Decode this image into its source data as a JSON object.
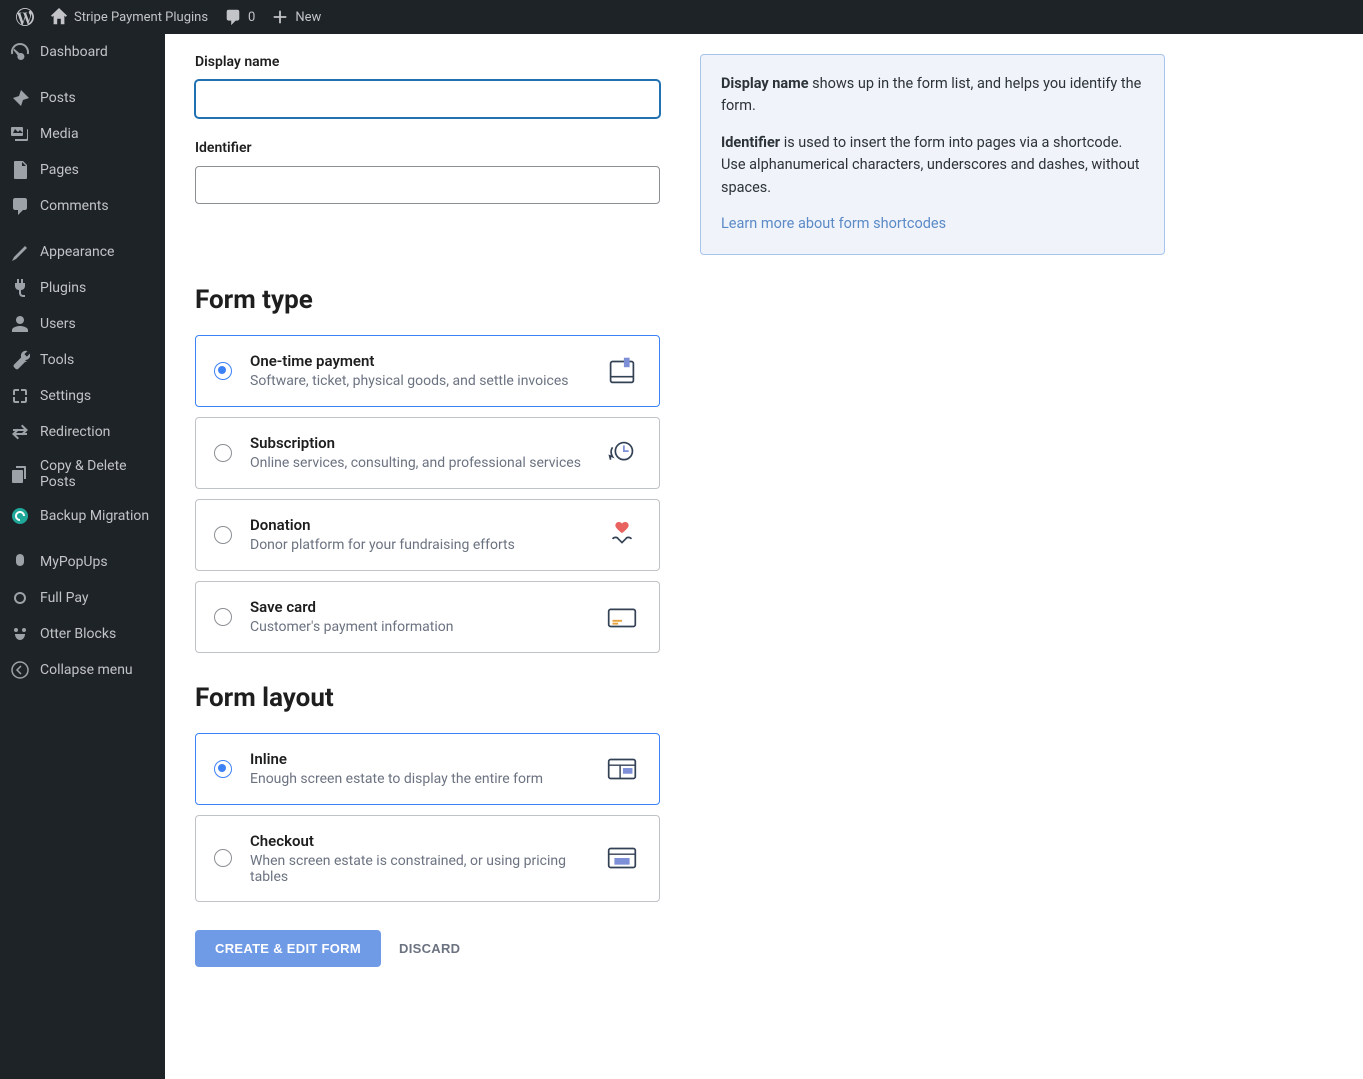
{
  "adminbar": {
    "site_title": "Stripe Payment Plugins",
    "comments_count": "0",
    "new_label": "New"
  },
  "sidebar": {
    "items": [
      {
        "label": "Dashboard",
        "icon": "dashboard"
      },
      {
        "label": "Posts",
        "icon": "pin"
      },
      {
        "label": "Media",
        "icon": "media"
      },
      {
        "label": "Pages",
        "icon": "pages"
      },
      {
        "label": "Comments",
        "icon": "comments"
      },
      {
        "label": "Appearance",
        "icon": "appearance"
      },
      {
        "label": "Plugins",
        "icon": "plugins"
      },
      {
        "label": "Users",
        "icon": "users"
      },
      {
        "label": "Tools",
        "icon": "tools"
      },
      {
        "label": "Settings",
        "icon": "settings"
      },
      {
        "label": "Redirection",
        "icon": "redirection"
      },
      {
        "label": "Copy & Delete Posts",
        "icon": "copy"
      },
      {
        "label": "Backup Migration",
        "icon": "backup"
      },
      {
        "label": "MyPopUps",
        "icon": "popup"
      },
      {
        "label": "Full Pay",
        "icon": "fullpay"
      },
      {
        "label": "Otter Blocks",
        "icon": "otter"
      },
      {
        "label": "Collapse menu",
        "icon": "collapse"
      }
    ]
  },
  "form": {
    "display_name_label": "Display name",
    "display_name_value": "",
    "identifier_label": "Identifier",
    "identifier_value": ""
  },
  "info": {
    "p1_strong": "Display name",
    "p1_rest": " shows up in the form list, and helps you identify the form.",
    "p2_strong": "Identifier",
    "p2_rest": " is used to insert the form into pages via a shortcode. Use alphanumerical characters, underscores and dashes, without spaces.",
    "link": "Learn more about form shortcodes"
  },
  "sections": {
    "form_type": "Form type",
    "form_layout": "Form layout"
  },
  "form_types": [
    {
      "title": "One-time payment",
      "desc": "Software, ticket, physical goods, and settle invoices",
      "selected": true,
      "icon": "book"
    },
    {
      "title": "Subscription",
      "desc": "Online services, consulting, and professional services",
      "selected": false,
      "icon": "recurring"
    },
    {
      "title": "Donation",
      "desc": "Donor platform for your fundraising efforts",
      "selected": false,
      "icon": "heart"
    },
    {
      "title": "Save card",
      "desc": "Customer's payment information",
      "selected": false,
      "icon": "card"
    }
  ],
  "form_layouts": [
    {
      "title": "Inline",
      "desc": "Enough screen estate to display the entire form",
      "selected": true,
      "icon": "inline"
    },
    {
      "title": "Checkout",
      "desc": "When screen estate is constrained, or using pricing tables",
      "selected": false,
      "icon": "checkout"
    }
  ],
  "actions": {
    "create": "CREATE & EDIT FORM",
    "discard": "DISCARD"
  }
}
